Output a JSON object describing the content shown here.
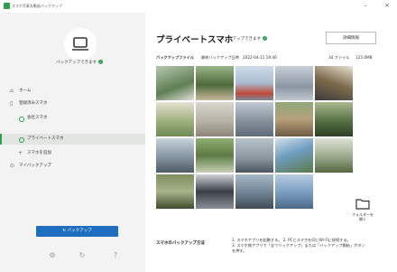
{
  "window": {
    "title": "スマホ写真＆動画バックアップ",
    "minimize": "–",
    "close": "×"
  },
  "sidebar": {
    "device_status": "バックアップできます",
    "ok_mark": "✓",
    "items": [
      {
        "label": "ホーム",
        "icon": "home-icon"
      },
      {
        "label": "登録済みスマホ",
        "icon": "phone-icon"
      },
      {
        "label": "会社スマホ",
        "icon": "status-dot"
      },
      {
        "label": "プライベートスマホ",
        "icon": "status-dot"
      },
      {
        "label": "スマホを追加",
        "icon": "plus-icon"
      },
      {
        "label": "マイバックアップ",
        "icon": "backup-icon"
      }
    ],
    "backup_button": "↻ バックアップ",
    "footer_icons": [
      "settings-icon",
      "history-icon",
      "help-icon"
    ],
    "footer_glyphs": [
      "⚙",
      "↻",
      "?"
    ]
  },
  "main": {
    "title": "プライベートスマホ",
    "status": "バックアップできます",
    "ok_mark": "✓",
    "detail_button": "詳細情報",
    "meta": {
      "label": "バックアップファイル",
      "last_label": "最終バックアップ日時",
      "datetime": "2022-04-11 19:46",
      "count": "34 ファイル",
      "size": "125.0MB"
    },
    "open_folder_label_1": "フォルダーを",
    "open_folder_label_2": "開く",
    "method_label": "スマホのバックアップ方法",
    "method_lines": [
      "1. スマホアプリを起動する。 2. PCとスマホを同じWi-Fiに接続する。",
      "3. スマホ側アプリで「全てバックアップ」または「バックアップ開始」ボタン",
      "を押す。"
    ]
  },
  "colors": {
    "accent_green": "#2e9f4a",
    "primary_blue": "#1e6dbf",
    "sidebar_bg": "#f2f3f2"
  }
}
